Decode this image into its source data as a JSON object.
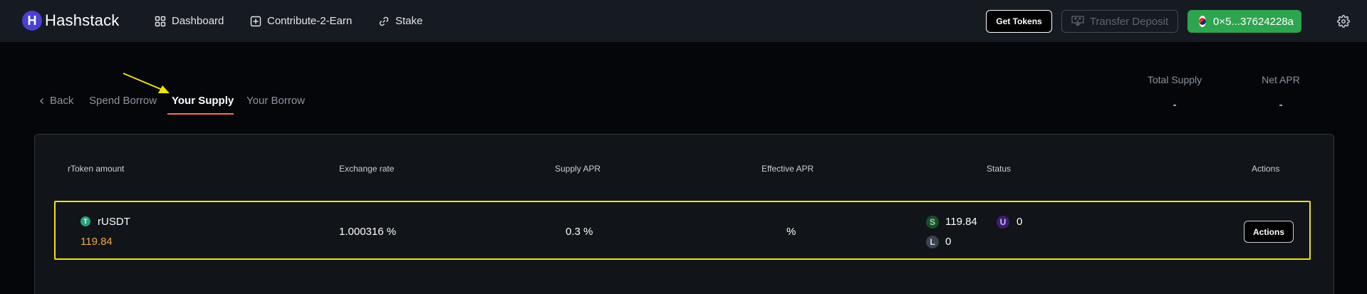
{
  "app": {
    "name": "Hashstack",
    "logo_letter": "H"
  },
  "nav": {
    "items": [
      {
        "label": "Dashboard",
        "icon": "grid-icon"
      },
      {
        "label": "Contribute-2-Earn",
        "icon": "plus-square-icon"
      },
      {
        "label": "Stake",
        "icon": "link-icon"
      }
    ],
    "get_tokens": "Get Tokens",
    "transfer_deposit": "Transfer Deposit",
    "wallet_address": "0×5...37624228a"
  },
  "tabs": {
    "back": "Back",
    "spend_borrow": "Spend Borrow",
    "your_supply": "Your Supply",
    "your_borrow": "Your Borrow"
  },
  "stats": {
    "total_supply_label": "Total Supply",
    "total_supply_value": "-",
    "net_apr_label": "Net APR",
    "net_apr_value": "-"
  },
  "table": {
    "headers": {
      "rtoken_amount": "rToken amount",
      "exchange_rate": "Exchange rate",
      "supply_apr": "Supply APR",
      "effective_apr": "Effective APR",
      "status": "Status",
      "actions": "Actions"
    },
    "rows": [
      {
        "token": "rUSDT",
        "token_icon": "T",
        "amount": "119.84",
        "exchange_rate": "1.000316 %",
        "supply_apr": "0.3 %",
        "effective_apr": "%",
        "status": {
          "s_label": "S",
          "s_value": "119.84",
          "u_label": "U",
          "u_value": "0",
          "l_label": "L",
          "l_value": "0"
        },
        "action_label": "Actions"
      }
    ]
  },
  "colors": {
    "accent_underline": "#f0705a",
    "wallet_green": "#2da44e",
    "highlight_yellow": "#f1e30c",
    "amount_orange": "#f0a84a"
  }
}
